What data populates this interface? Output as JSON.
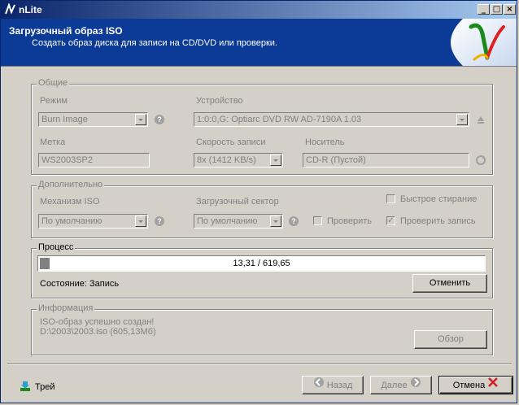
{
  "window": {
    "title": "nLite",
    "controls": {
      "minimize": "_",
      "maximize": "□",
      "close": "×"
    }
  },
  "header": {
    "title": "Загрузочный образ ISO",
    "subtitle": "Создать образ диска для записи на CD/DVD или проверки."
  },
  "general": {
    "label": "Общие",
    "mode": {
      "label": "Режим",
      "value": "Burn Image"
    },
    "device": {
      "label": "Устройство",
      "value": "1:0:0,G: Optiarc  DVD RW AD-7190A  1.03"
    },
    "volume_label": {
      "label": "Метка",
      "value": "WS2003SP2"
    },
    "write_speed": {
      "label": "Скорость записи",
      "value": "8x (1412 KB/s)"
    },
    "media": {
      "label": "Носитель",
      "value": "CD-R (Пустой)"
    }
  },
  "advanced": {
    "label": "Дополнительно",
    "iso_engine": {
      "label": "Механизм ISO",
      "value": "По умолчанию"
    },
    "boot_sector": {
      "label": "Загрузочный сектор",
      "value": "По умолчанию"
    },
    "quick_erase": {
      "label": "Быстрое стирание",
      "checked": false
    },
    "verify": {
      "label": "Проверить",
      "checked": false
    },
    "verify_write": {
      "label": "Проверить запись",
      "checked": true
    }
  },
  "process": {
    "label": "Процесс",
    "progress_text": "13,31 / 619,65",
    "progress_fraction": 0.0215,
    "status": "Состояние: Запись",
    "cancel_label": "Отменить"
  },
  "info": {
    "label": "Информация",
    "line1": "ISO-образ успешно создан!",
    "line2": "D:\\2003\\2003.iso (605,13Мб)",
    "browse_label": "Обзор"
  },
  "footer": {
    "tray_label": "Трей",
    "back_label": "Назад",
    "next_label": "Далее",
    "cancel_label": "Отмена"
  },
  "colors": {
    "titlebar_start": "#0a246a",
    "header_bg": "#0b3b96",
    "disabled_text": "#808080"
  }
}
